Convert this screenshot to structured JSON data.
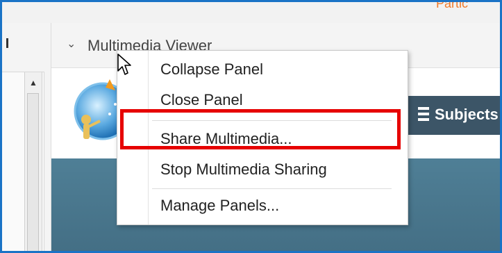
{
  "top_bar": {
    "participants_label": "Partic"
  },
  "panel": {
    "title": "Multimedia Viewer"
  },
  "viewer": {
    "nav_subjects_label": "Subjects"
  },
  "context_menu": {
    "items": [
      {
        "label": "Collapse Panel"
      },
      {
        "label": "Close Panel"
      },
      {
        "label": "Share Multimedia..."
      },
      {
        "label": "Stop Multimedia Sharing"
      },
      {
        "label": "Manage Panels..."
      }
    ]
  },
  "colors": {
    "frame_border": "#1a73c6",
    "highlight": "#e60000",
    "participants_tab": "#f07a2a",
    "navbar": "#3c5567",
    "banner": "#4f7f96"
  },
  "icons": [
    "chevron-down-icon",
    "scroll-up-arrow-icon",
    "hamburger-menu-icon",
    "mouse-pointer-icon",
    "site-logo"
  ]
}
